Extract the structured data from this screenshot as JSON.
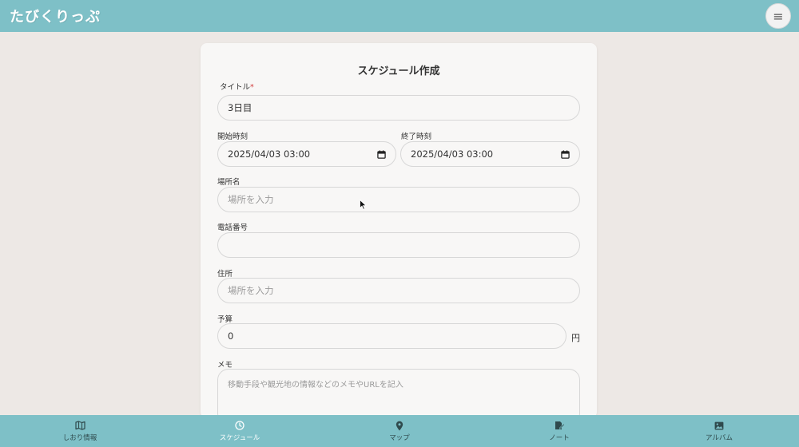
{
  "header": {
    "logo": "たびくりっぷ",
    "menu_icon": "hamburger-icon",
    "menu_glyph": "≡"
  },
  "form": {
    "title": "スケジュール作成",
    "title_label": "タイトル",
    "required_mark": "*",
    "title_value": "3日目",
    "start_label": "開始時刻",
    "start_value": "2025/04/03 03:00",
    "end_label": "終了時刻",
    "end_value": "2025/04/03 03:00",
    "place_label": "場所名",
    "place_placeholder": "場所を入力",
    "phone_label": "電話番号",
    "phone_value": "",
    "address_label": "住所",
    "address_placeholder": "場所を入力",
    "budget_label": "予算",
    "budget_value": "0",
    "budget_unit": "円",
    "memo_label": "メモ",
    "memo_placeholder": "移動手段や観光地の情報などのメモやURLを記入"
  },
  "nav": {
    "items": [
      {
        "label": "しおり情報",
        "icon": "map-icon"
      },
      {
        "label": "スケジュール",
        "icon": "clock-icon",
        "active": true
      },
      {
        "label": "マップ",
        "icon": "pin-icon"
      },
      {
        "label": "ノート",
        "icon": "note-icon"
      },
      {
        "label": "アルバム",
        "icon": "image-icon"
      }
    ]
  },
  "colors": {
    "bar": "#7ec0c7",
    "background": "#ede8e5",
    "card": "#f8f7f6",
    "required": "#d23c3c"
  }
}
